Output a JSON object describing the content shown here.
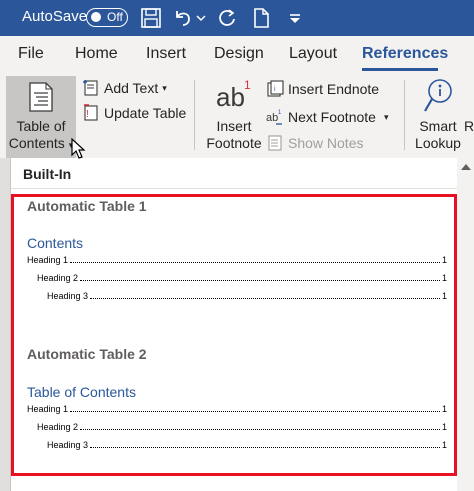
{
  "titlebar": {
    "autosave_label": "AutoSave",
    "autosave_state": "Off"
  },
  "tabs": [
    {
      "label": "File"
    },
    {
      "label": "Home"
    },
    {
      "label": "Insert"
    },
    {
      "label": "Design"
    },
    {
      "label": "Layout"
    },
    {
      "label": "References"
    }
  ],
  "ribbon": {
    "toc_label_1": "Table of",
    "toc_label_2": "Contents",
    "add_text": "Add Text",
    "update_table": "Update Table",
    "insert_footnote_1": "Insert",
    "insert_footnote_2": "Footnote",
    "footnote_glyph": "ab",
    "footnote_sup": "1",
    "insert_endnote": "Insert Endnote",
    "next_footnote": "Next Footnote",
    "show_notes": "Show Notes",
    "smart_lookup_1": "Smart",
    "smart_lookup_2": "Lookup",
    "cut_off_label": "R"
  },
  "panel": {
    "header": "Built-In",
    "galleries": [
      {
        "name": "Automatic Table 1",
        "contents_title": "Contents",
        "rows": [
          {
            "text": "Heading 1",
            "page": "1"
          },
          {
            "text": "Heading 2",
            "page": "1"
          },
          {
            "text": "Heading 3",
            "page": "1"
          }
        ]
      },
      {
        "name": "Automatic Table 2",
        "contents_title": "Table of Contents",
        "rows": [
          {
            "text": "Heading 1",
            "page": "1"
          },
          {
            "text": "Heading 2",
            "page": "1"
          },
          {
            "text": "Heading 3",
            "page": "1"
          }
        ]
      }
    ]
  },
  "colors": {
    "titlebar": "#2b579a",
    "accent": "#2b579a",
    "highlight": "#e81123"
  }
}
